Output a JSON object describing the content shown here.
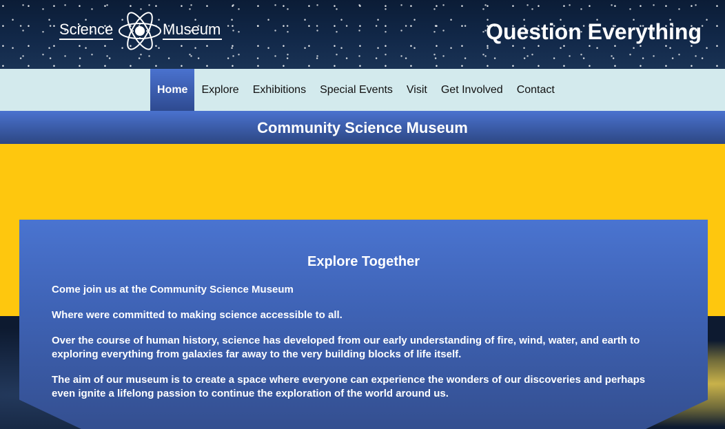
{
  "header": {
    "logo_word_left": "Science",
    "logo_word_right": "Museum",
    "tagline": "Question Everything"
  },
  "nav": {
    "items": [
      {
        "label": "Home",
        "active": true
      },
      {
        "label": "Explore"
      },
      {
        "label": "Exhibitions"
      },
      {
        "label": "Special Events"
      },
      {
        "label": "Visit"
      },
      {
        "label": "Get Involved"
      },
      {
        "label": "Contact"
      }
    ]
  },
  "page_title": "Community Science Museum",
  "section": {
    "heading": "Explore Together",
    "paragraphs": [
      "Come join us at the Community Science Museum",
      "Where were committed to making science accessible to all.",
      "Over the course of human history, science has developed from our early understanding of fire, wind, water, and earth to exploring everything from galaxies far away to the very building blocks of life itself.",
      "The aim of our museum is to create a space where everyone can experience the wonders of our discoveries and perhaps even ignite a lifelong passion to continue the exploration of the world around us."
    ]
  },
  "colors": {
    "nav_bg": "#d3eaed",
    "accent_blue": "#4a72cf",
    "yellow": "#fec70e"
  },
  "icons": [
    "atom-logo-icon"
  ]
}
